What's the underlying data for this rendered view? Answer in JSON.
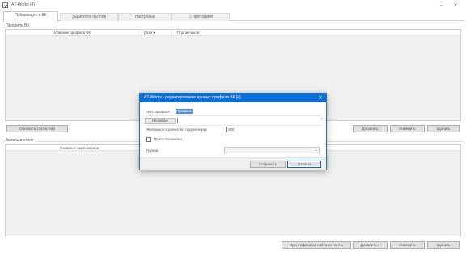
{
  "window": {
    "title": "АT-Works [4]",
    "controls": {
      "minimize": "–",
      "close": "×"
    }
  },
  "tabs": [
    {
      "label": "Публикация в ВК"
    },
    {
      "label": "Заработок баллов"
    },
    {
      "label": "Настройки"
    },
    {
      "label": "О программе"
    }
  ],
  "profiles_group": {
    "title": "Профили ВК",
    "columns": [
      "Название профиля ВК",
      "Дата ▾",
      "Подписчиков"
    ],
    "refresh_button": "Обновить статистику",
    "add_button": "Добавить",
    "edit_button": "Изменить",
    "delete_button": "Удалить"
  },
  "posts_group": {
    "title": "Запись в стене",
    "columns": [
      "Название видеозаписи"
    ],
    "source_button": "Идентификатор сайта из ленты",
    "add_button": "Добавить ▾",
    "edit_button": "Изменить",
    "delete_button": "Удалить"
  },
  "dialog": {
    "title": "АT-Works - редактирование данных профиля ВК [4]",
    "url_label": "URL профиля",
    "url_selected": "Профиль",
    "name_label": "Название",
    "subs_label": "Желаемое количество подписчиков",
    "subs_value": "300",
    "paused_label": "Приостановлено",
    "group_label": "Группа",
    "help": "?",
    "save_button": "Сохранить",
    "cancel_button": "Отмена"
  }
}
